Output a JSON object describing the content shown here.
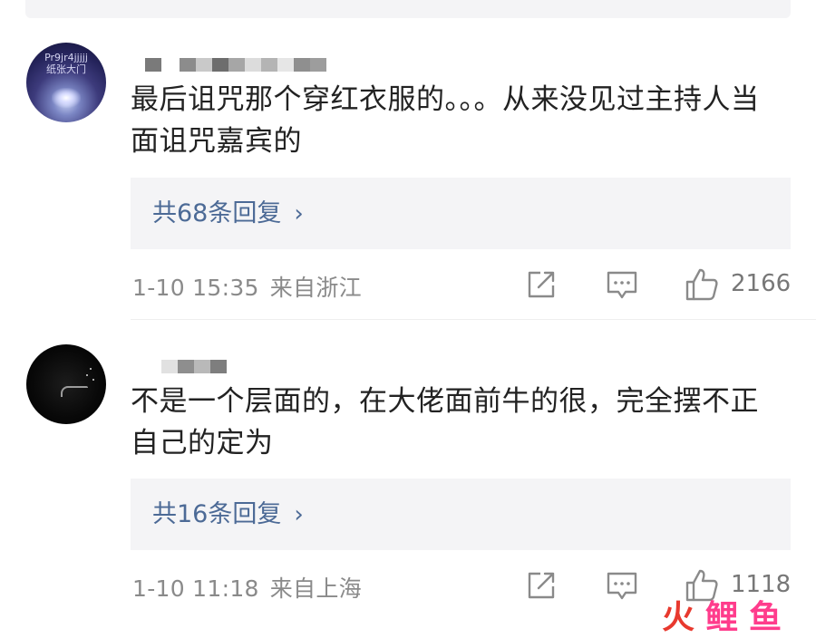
{
  "comments": [
    {
      "text": "最后诅咒那个穿红衣服的。。。从来没见过主持人当面诅咒嘉宾的",
      "avatar_text": [
        "Pr9jr4jjjjj",
        "纸张大门"
      ],
      "replies_label": "共68条回复",
      "time": "1-10 15:35",
      "location": "来自浙江",
      "likes": "2166"
    },
    {
      "text": "不是一个层面的，在大佬面前牛的很，完全摆不正自己的定为",
      "replies_label": "共16条回复",
      "time": "1-10 11:18",
      "location": "来自上海",
      "likes": "1118"
    }
  ],
  "icons": {
    "share": "share-icon",
    "comment": "comment-icon",
    "like": "thumbs-up-icon",
    "chevron": "chevron-right-icon"
  },
  "colors": {
    "reply_link": "#4c6a96",
    "reply_bg": "#f4f4f6",
    "meta": "#8a8a8a",
    "watermark_red": "#e8392e",
    "watermark_pink": "#ff3c8c"
  },
  "watermark": {
    "chars": [
      "火",
      "鲤",
      "鱼"
    ]
  }
}
